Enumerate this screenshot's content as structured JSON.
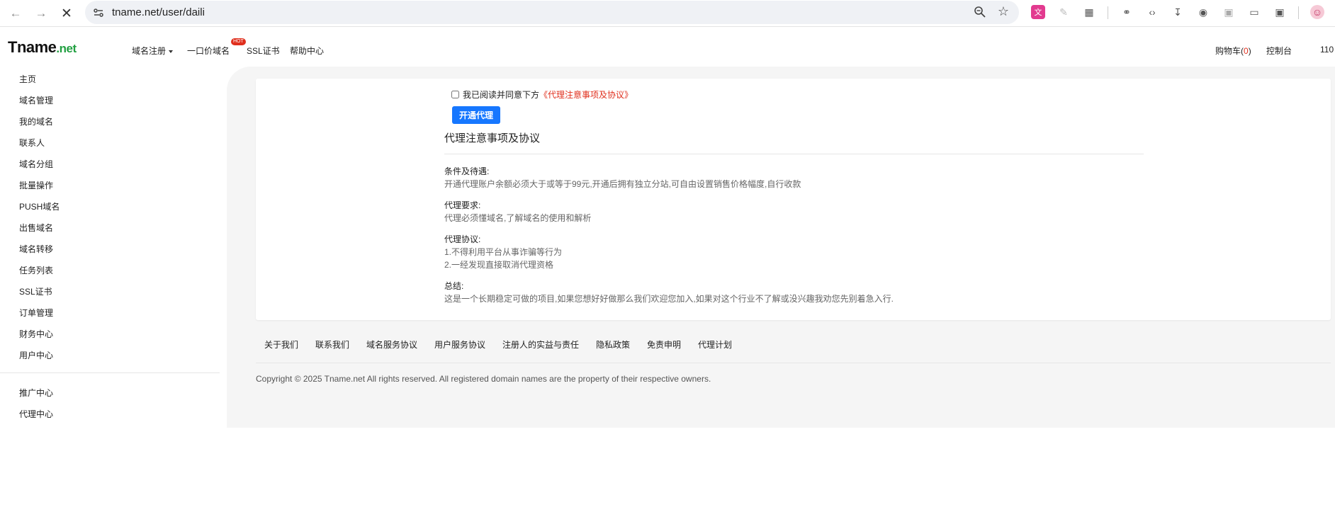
{
  "browser": {
    "url": "tname.net/user/daili"
  },
  "header": {
    "logo_main": "Tname",
    "logo_tld": ".net",
    "nav": [
      {
        "label": "域名注册"
      },
      {
        "label": "一口价域名"
      },
      {
        "label": "SSL证书"
      },
      {
        "label": "帮助中心"
      }
    ],
    "hot_badge": "HOT",
    "cart_label": "购物车(",
    "cart_count": "0",
    "cart_close": ")",
    "console_label": "控制台",
    "user_id_partial": "110"
  },
  "sidebar": {
    "items": [
      {
        "label": "主页"
      },
      {
        "label": "域名管理"
      },
      {
        "label": "我的域名"
      },
      {
        "label": "联系人"
      },
      {
        "label": "域名分组"
      },
      {
        "label": "批量操作"
      },
      {
        "label": "PUSH域名"
      },
      {
        "label": "出售域名"
      },
      {
        "label": "域名转移"
      },
      {
        "label": "任务列表"
      },
      {
        "label": "SSL证书"
      },
      {
        "label": "订单管理"
      },
      {
        "label": "财务中心"
      },
      {
        "label": "用户中心"
      }
    ],
    "bottom_items": [
      {
        "label": "推广中心"
      },
      {
        "label": "代理中心"
      }
    ]
  },
  "main": {
    "agree_text": "我已阅读并同意下方",
    "agree_link": "《代理注意事项及协议》",
    "agree_checked": false,
    "open_button": "开通代理",
    "doc_title": "代理注意事项及协议",
    "sections": [
      {
        "head": "条件及待遇:",
        "lines": [
          "开通代理账户余额必须大于或等于99元,开通后拥有独立分站,可自由设置销售价格幅度,自行收款"
        ]
      },
      {
        "head": "代理要求:",
        "lines": [
          "代理必须懂域名,了解域名的使用和解析"
        ]
      },
      {
        "head": "代理协议:",
        "lines": [
          "1.不得利用平台从事诈骗等行为",
          "2.一经发现直接取消代理资格"
        ]
      },
      {
        "head": "总结:",
        "lines": [
          "这是一个长期稳定可做的项目,如果您想好好做那么我们欢迎您加入,如果对这个行业不了解或没兴趣我劝您先别着急入行."
        ]
      }
    ]
  },
  "footer": {
    "links": [
      {
        "label": "关于我们"
      },
      {
        "label": "联系我们"
      },
      {
        "label": "域名服务协议"
      },
      {
        "label": "用户服务协议"
      },
      {
        "label": "注册人的实益与责任"
      },
      {
        "label": "隐私政策"
      },
      {
        "label": "免责申明"
      },
      {
        "label": "代理计划"
      }
    ],
    "copyright": "Copyright © 2025 Tname.net All rights reserved. All registered domain names are the property of their respective owners."
  }
}
